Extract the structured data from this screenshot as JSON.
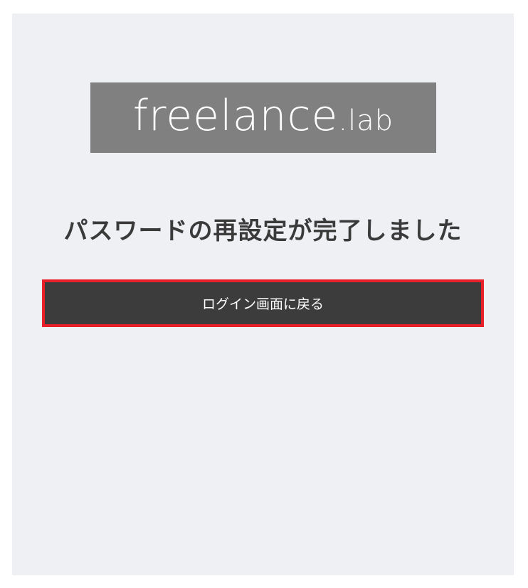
{
  "logo": {
    "main": "freelance",
    "sub": ".lab"
  },
  "heading": "パスワードの再設定が完了しました",
  "back_button_label": "ログイン画面に戻る",
  "colors": {
    "panel_bg": "#eff0f4",
    "logo_bg": "#808080",
    "button_bg": "#3c3c3c",
    "button_border": "#e8202a",
    "heading_text": "#3a3a3a"
  }
}
